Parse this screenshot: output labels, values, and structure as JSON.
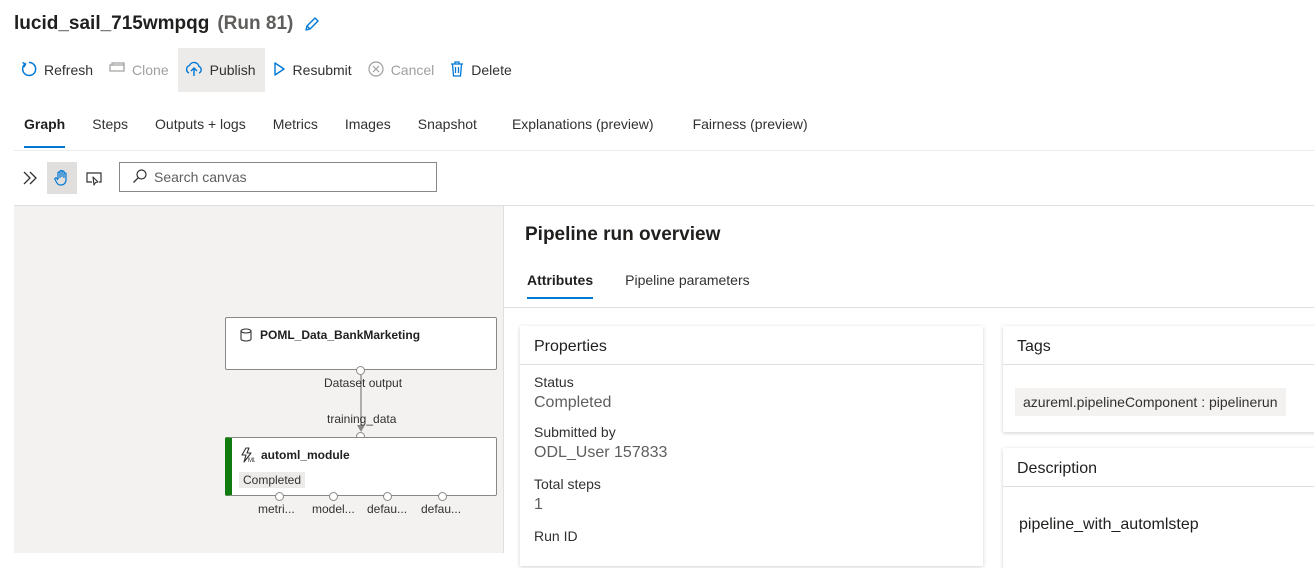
{
  "header": {
    "title": "lucid_sail_715wmpqg",
    "run": "(Run 81)"
  },
  "toolbar": {
    "refresh": "Refresh",
    "clone": "Clone",
    "publish": "Publish",
    "resubmit": "Resubmit",
    "cancel": "Cancel",
    "delete": "Delete"
  },
  "tabs": [
    "Graph",
    "Steps",
    "Outputs + logs",
    "Metrics",
    "Images",
    "Snapshot",
    "Explanations (preview)",
    "Fairness (preview)"
  ],
  "canvas": {
    "search_placeholder": "Search canvas"
  },
  "graph": {
    "dataset_node": {
      "title": "POML_Data_BankMarketing",
      "output_label": "Dataset output"
    },
    "edge_input_label": "training_data",
    "module_node": {
      "title": "automl_module",
      "status": "Completed",
      "status_color": "#107c10",
      "outputs": [
        "metri...",
        "model...",
        "defau...",
        "defau..."
      ]
    }
  },
  "overview": {
    "title": "Pipeline run overview",
    "tabs": [
      "Attributes",
      "Pipeline parameters"
    ],
    "properties": {
      "header": "Properties",
      "status_label": "Status",
      "status_value": "Completed",
      "submitted_label": "Submitted by",
      "submitted_value": "ODL_User 157833",
      "steps_label": "Total steps",
      "steps_value": "1",
      "runid_label": "Run ID"
    },
    "tags": {
      "header": "Tags",
      "items": [
        "azureml.pipelineComponent : pipelinerun"
      ]
    },
    "description": {
      "header": "Description",
      "text": "pipeline_with_automlstep"
    }
  },
  "colors": {
    "accent": "#0078d4",
    "success": "#107c10"
  }
}
